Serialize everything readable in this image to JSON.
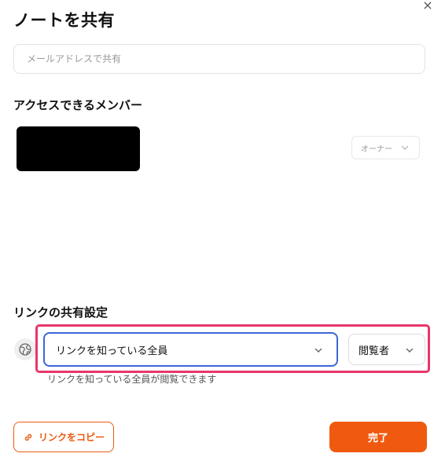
{
  "dialog": {
    "title": "ノートを共有",
    "close_icon": "×"
  },
  "email": {
    "placeholder": "メールアドレスで共有",
    "value": ""
  },
  "members": {
    "heading": "アクセスできるメンバー",
    "owner_role": "オーナー"
  },
  "link_settings": {
    "heading": "リンクの共有設定",
    "access_value": "リンクを知っている全員",
    "role_value": "閲覧者",
    "description": "リンクを知っている全員が閲覧できます"
  },
  "buttons": {
    "copy_link": "リンクをコピー",
    "done": "完了"
  },
  "colors": {
    "accent": "#ef5a10",
    "focus": "#3b67d6",
    "highlight": "#e8366a"
  }
}
